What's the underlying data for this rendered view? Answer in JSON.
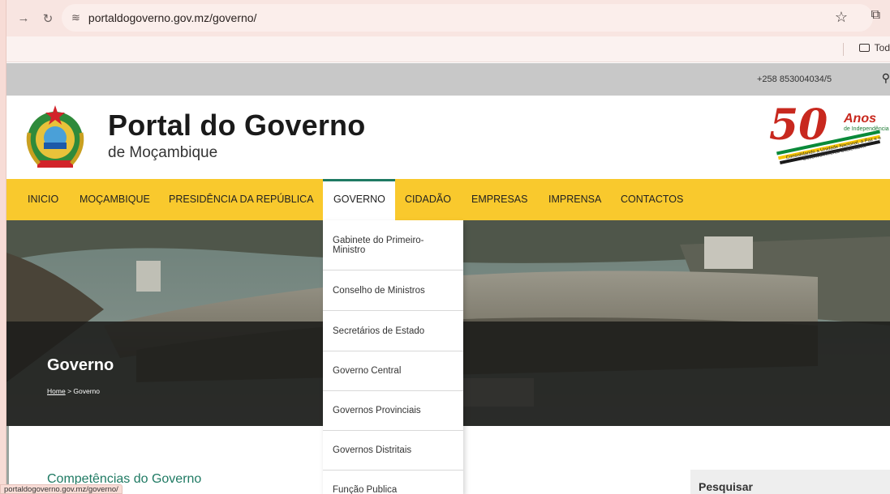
{
  "browser": {
    "back_icon": "arrow-right-icon",
    "reload_icon": "reload-icon",
    "url": "portaldogoverno.gov.mz/governo/",
    "bookmark_folder_label": "Tod",
    "status_url": "portaldogoverno.gov.mz/governo/"
  },
  "topbar": {
    "phone": "+258 853004034/5",
    "search_icon": "search-icon"
  },
  "header": {
    "title": "Portal do Governo",
    "subtitle": "de Moçambique",
    "badge_number": "50",
    "badge_anos": "Anos",
    "badge_independencia": "de Independência",
    "badge_motto": "Consolidando a Unidade Nacional, a Paz e o Desenvolvimento Sustentável"
  },
  "nav": {
    "items": [
      {
        "label": "INICIO"
      },
      {
        "label": "MOÇAMBIQUE"
      },
      {
        "label": "PRESIDÊNCIA DA REPÚBLICA"
      },
      {
        "label": "GOVERNO"
      },
      {
        "label": "CIDADÃO"
      },
      {
        "label": "EMPRESAS"
      },
      {
        "label": "IMPRENSA"
      },
      {
        "label": "CONTACTOS"
      }
    ],
    "active": "GOVERNO"
  },
  "dropdown": {
    "items": [
      {
        "label": "Gabinete do Primeiro-Ministro"
      },
      {
        "label": "Conselho de Ministros"
      },
      {
        "label": "Secretários de Estado"
      },
      {
        "label": "Governo Central"
      },
      {
        "label": "Governos Provinciais"
      },
      {
        "label": "Governos Distritais"
      },
      {
        "label": "Função Publica"
      }
    ]
  },
  "hero": {
    "title": "Governo",
    "breadcrumb_home": "Home",
    "breadcrumb_sep": ">",
    "breadcrumb_current": "Governo"
  },
  "content": {
    "section_title": "Competências do Governo",
    "sidebar_title": "Pesquisar"
  },
  "colors": {
    "nav_bg": "#f9c92d",
    "accent_green": "#1f7a63",
    "topbar_bg": "#c8c8c8"
  }
}
